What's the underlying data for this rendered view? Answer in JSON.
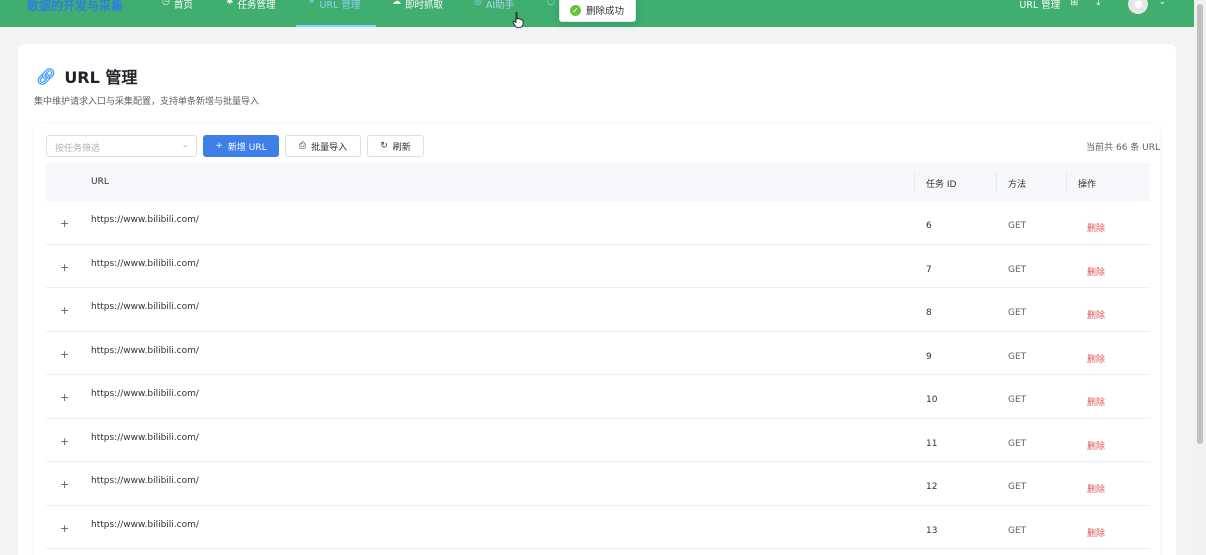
{
  "nav": {
    "brand": "数据的开发与采集",
    "items": [
      {
        "icon": "clock-icon",
        "label": "首页"
      },
      {
        "icon": "bug-icon",
        "label": "任务管理"
      },
      {
        "icon": "link-icon",
        "label": "URL 管理"
      },
      {
        "icon": "cloud-icon",
        "label": "即时抓取"
      },
      {
        "icon": "robot-icon",
        "label": "AI助手"
      },
      {
        "icon": "circle-icon",
        "label": ""
      }
    ],
    "right_label": "URL 管理"
  },
  "toast": {
    "text": "删除成功"
  },
  "page": {
    "title": "URL 管理",
    "subtitle": "集中维护请求入口与采集配置，支持单条新增与批量导入"
  },
  "toolbar": {
    "filter_placeholder": "按任务筛选",
    "add_label": "新增 URL",
    "import_label": "批量导入",
    "refresh_label": "刷新",
    "count_text": "当前共 66 条 URL"
  },
  "table": {
    "columns": [
      "URL",
      "任务 ID",
      "方法",
      "操作"
    ],
    "rows": [
      {
        "url": "https://www.bilibili.com/",
        "task_id": "6",
        "method": "GET",
        "action": "删除"
      },
      {
        "url": "https://www.bilibili.com/",
        "task_id": "7",
        "method": "GET",
        "action": "删除"
      },
      {
        "url": "https://www.bilibili.com/",
        "task_id": "8",
        "method": "GET",
        "action": "删除"
      },
      {
        "url": "https://www.bilibili.com/",
        "task_id": "9",
        "method": "GET",
        "action": "删除"
      },
      {
        "url": "https://www.bilibili.com/",
        "task_id": "10",
        "method": "GET",
        "action": "删除"
      },
      {
        "url": "https://www.bilibili.com/",
        "task_id": "11",
        "method": "GET",
        "action": "删除"
      },
      {
        "url": "https://www.bilibili.com/",
        "task_id": "12",
        "method": "GET",
        "action": "删除"
      },
      {
        "url": "https://www.bilibili.com/",
        "task_id": "13",
        "method": "GET",
        "action": "删除"
      }
    ]
  },
  "colors": {
    "nav_bg": "#3fae6f",
    "primary": "#3f7fe8",
    "danger": "#e05555",
    "success": "#67c23a"
  }
}
